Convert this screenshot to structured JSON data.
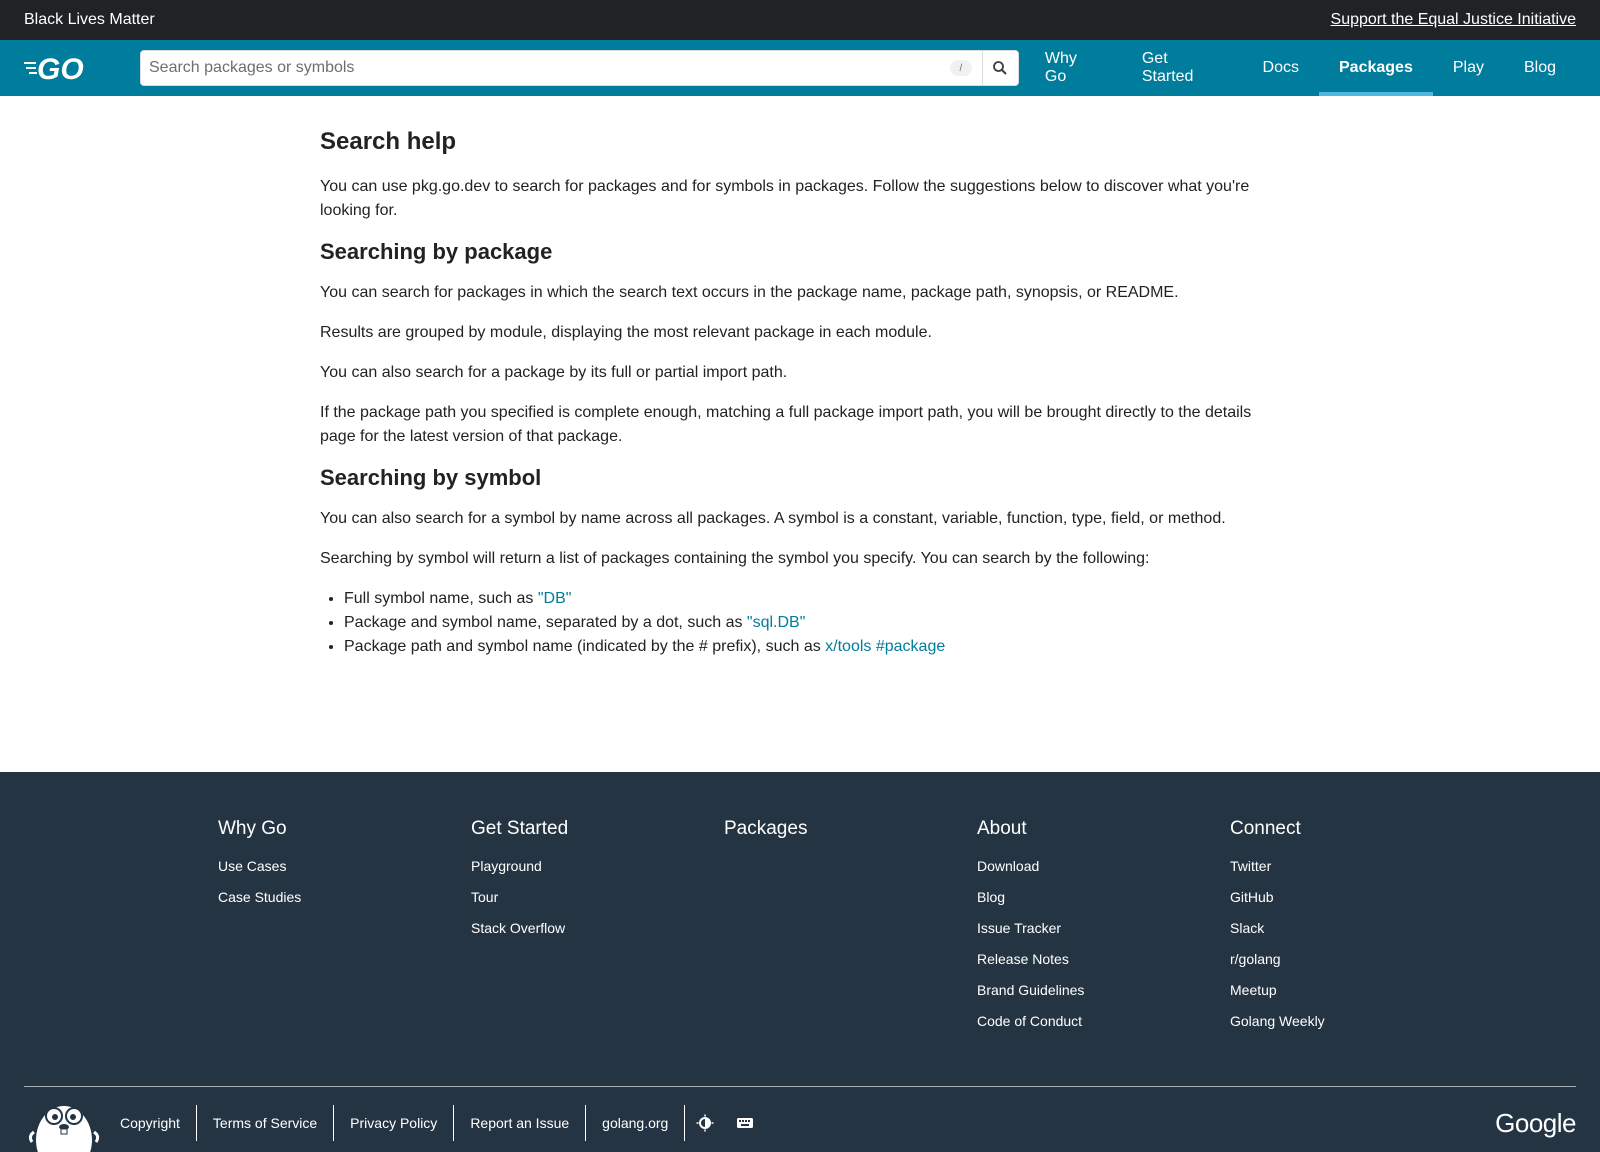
{
  "banner": {
    "left_text": "Black Lives Matter",
    "right_link": "Support the Equal Justice Initiative"
  },
  "header": {
    "search_placeholder": "Search packages or symbols",
    "search_shortcut": "/",
    "nav": [
      {
        "label": "Why Go"
      },
      {
        "label": "Get Started"
      },
      {
        "label": "Docs"
      },
      {
        "label": "Packages"
      },
      {
        "label": "Play"
      },
      {
        "label": "Blog"
      }
    ]
  },
  "main": {
    "title": "Search help",
    "intro": "You can use pkg.go.dev to search for packages and for symbols in packages. Follow the suggestions below to discover what you're looking for.",
    "package_heading": "Searching by package",
    "package_p1": "You can search for packages in which the search text occurs in the package name, package path, synopsis, or README.",
    "package_p2": "Results are grouped by module, displaying the most relevant package in each module.",
    "package_p3": "You can also search for a package by its full or partial import path.",
    "package_p4": "If the package path you specified is complete enough, matching a full package import path, you will be brought directly to the details page for the latest version of that package.",
    "symbol_heading": "Searching by symbol",
    "symbol_p1": "You can also search for a symbol by name across all packages. A symbol is a constant, variable, function, type, field, or method.",
    "symbol_p2": "Searching by symbol will return a list of packages containing the symbol you specify. You can search by the following:",
    "list": [
      {
        "text": "Full symbol name, such as ",
        "link": "\"DB\""
      },
      {
        "text": "Package and symbol name, separated by a dot, such as ",
        "link": "\"sql.DB\""
      },
      {
        "text": "Package path and symbol name (indicated by the # prefix), such as ",
        "link": "x/tools #package"
      }
    ]
  },
  "footer": {
    "columns": [
      {
        "title": "Why Go",
        "links": [
          "Use Cases",
          "Case Studies"
        ]
      },
      {
        "title": "Get Started",
        "links": [
          "Playground",
          "Tour",
          "Stack Overflow"
        ]
      },
      {
        "title": "Packages",
        "links": []
      },
      {
        "title": "About",
        "links": [
          "Download",
          "Blog",
          "Issue Tracker",
          "Release Notes",
          "Brand Guidelines",
          "Code of Conduct"
        ]
      },
      {
        "title": "Connect",
        "links": [
          "Twitter",
          "GitHub",
          "Slack",
          "r/golang",
          "Meetup",
          "Golang Weekly"
        ]
      }
    ],
    "bottom_links": [
      "Copyright",
      "Terms of Service",
      "Privacy Policy",
      "Report an Issue",
      "golang.org"
    ],
    "google_logo": "Google"
  }
}
